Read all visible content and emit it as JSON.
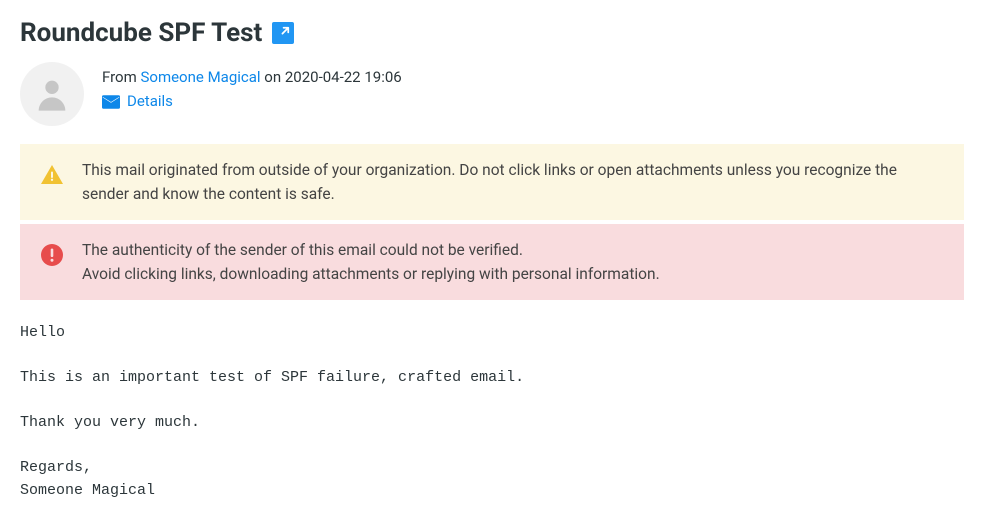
{
  "subject": "Roundcube SPF Test",
  "from_label": "From",
  "sender_name": "Someone Magical",
  "on_label": "on",
  "date": "2020-04-22 19:06",
  "details_label": "Details",
  "alerts": {
    "external": "This mail originated from outside of your organization. Do not click links or open attachments unless you recognize the sender and know the content is safe.",
    "auth_line1": "The authenticity of the sender of this email could not be verified.",
    "auth_line2": "Avoid clicking links, downloading attachments or replying with personal information."
  },
  "body": "Hello\n\nThis is an important test of SPF failure, crafted email.\n\nThank you very much.\n\nRegards,\nSomeone Magical"
}
